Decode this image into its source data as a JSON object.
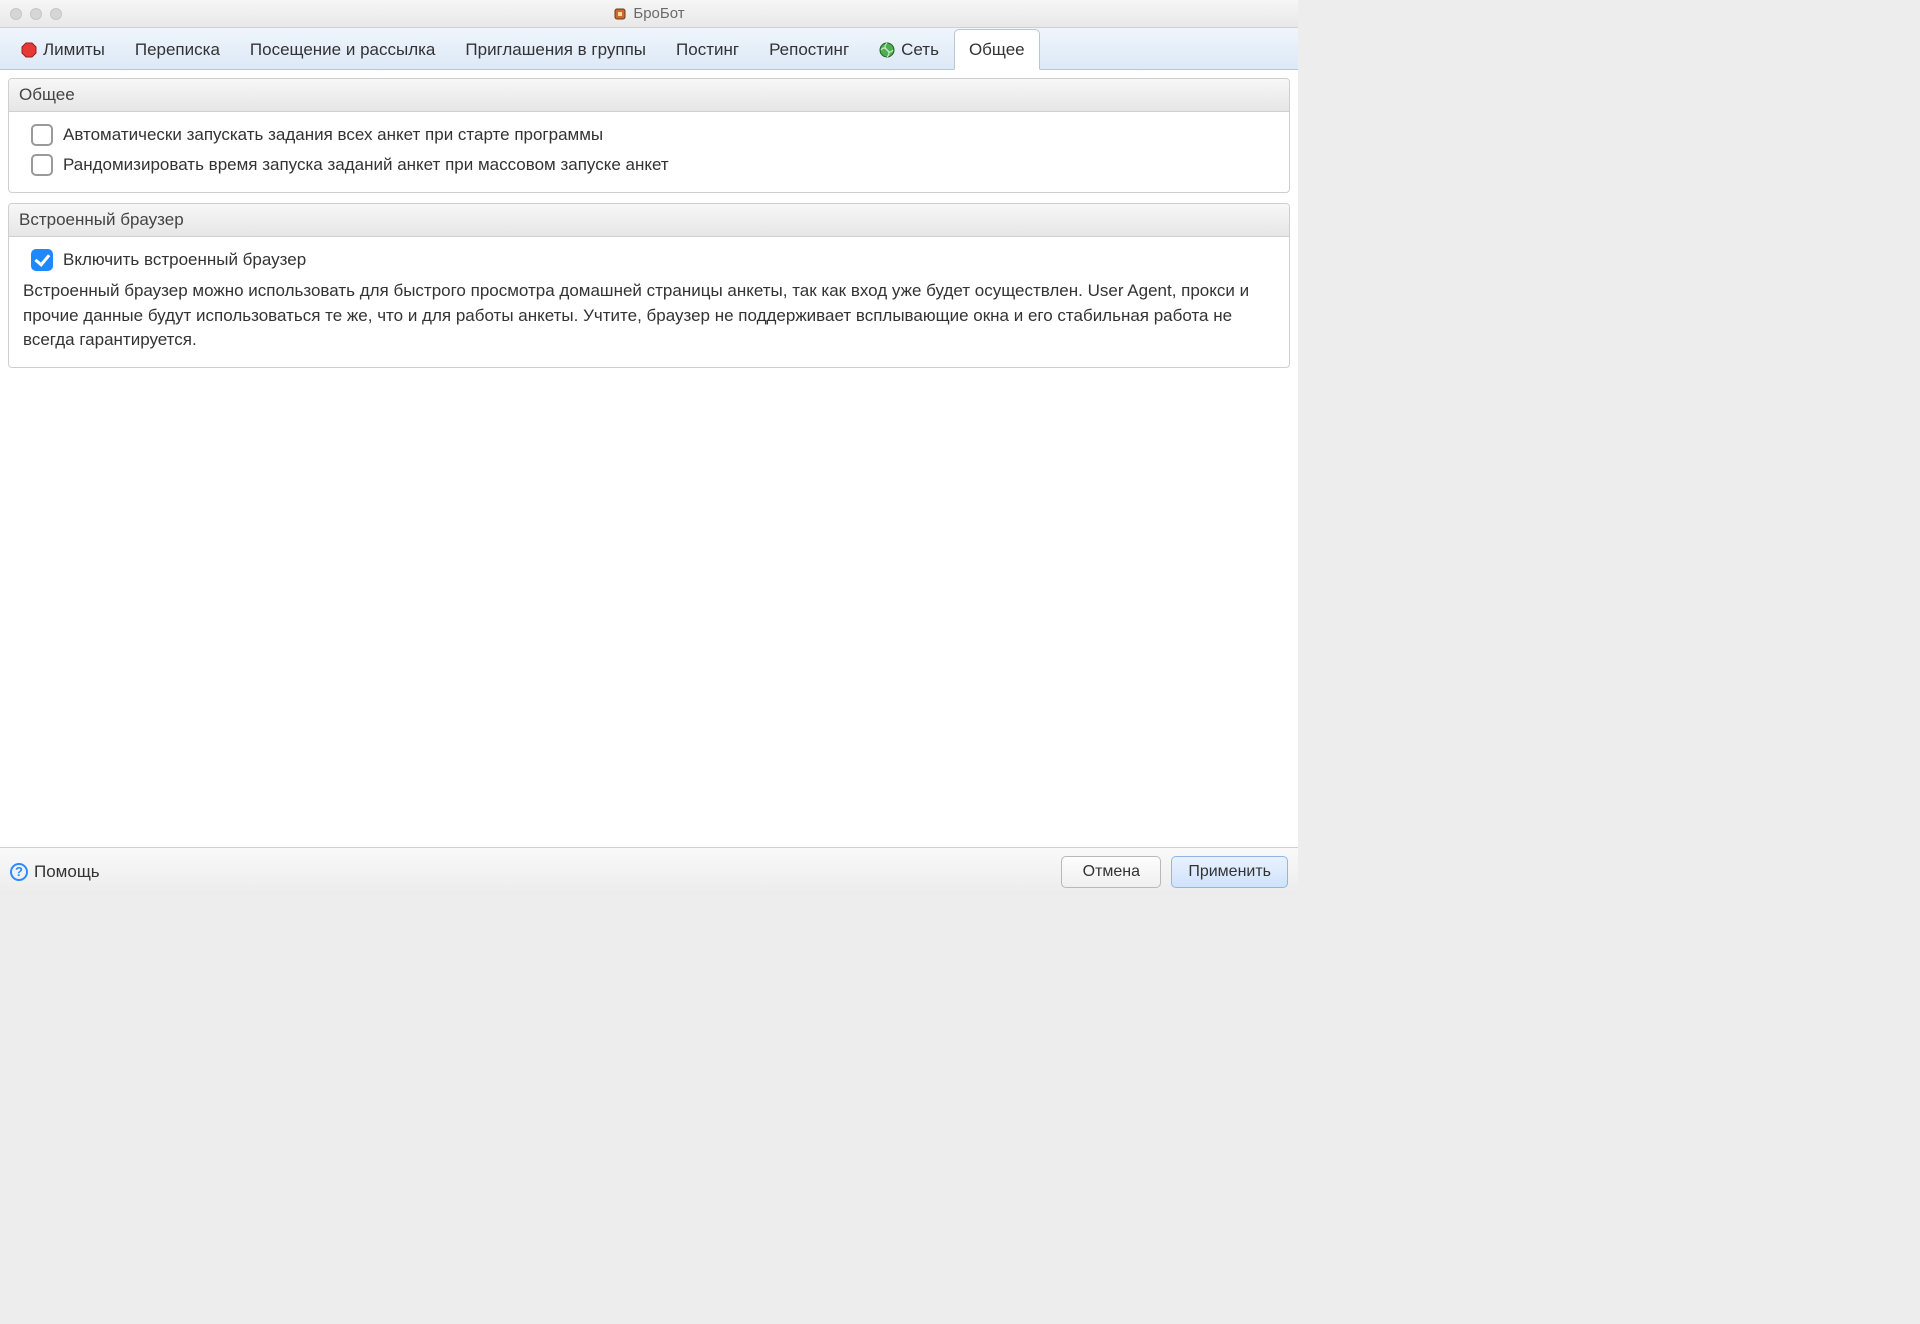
{
  "window": {
    "title": "БроБот"
  },
  "tabs": {
    "limits": {
      "label": "Лимиты"
    },
    "chat": {
      "label": "Переписка"
    },
    "visits": {
      "label": "Посещение и рассылка"
    },
    "invites": {
      "label": "Приглашения в группы"
    },
    "posting": {
      "label": "Постинг"
    },
    "reposting": {
      "label": "Репостинг"
    },
    "network": {
      "label": "Сеть"
    },
    "general": {
      "label": "Общее"
    }
  },
  "panel_general": {
    "title": "Общее",
    "opt_autostart": {
      "label": "Автоматически запускать задания всех анкет при старте программы",
      "checked": false
    },
    "opt_randomize": {
      "label": "Рандомизировать время запуска заданий анкет при массовом запуске анкет",
      "checked": false
    }
  },
  "panel_browser": {
    "title": "Встроенный браузер",
    "opt_enable": {
      "label": "Включить встроенный браузер",
      "checked": true
    },
    "description": "Встроенный браузер можно использовать для быстрого просмотра домашней страницы анкеты, так как вход уже будет осуществлен. User Agent, прокси и прочие данные будут использоваться те же, что и для работы анкеты. Учтите, браузер не поддерживает всплывающие окна и его стабильная работа не всегда гарантируется."
  },
  "footer": {
    "help": "Помощь",
    "cancel": "Отмена",
    "apply": "Применить"
  }
}
